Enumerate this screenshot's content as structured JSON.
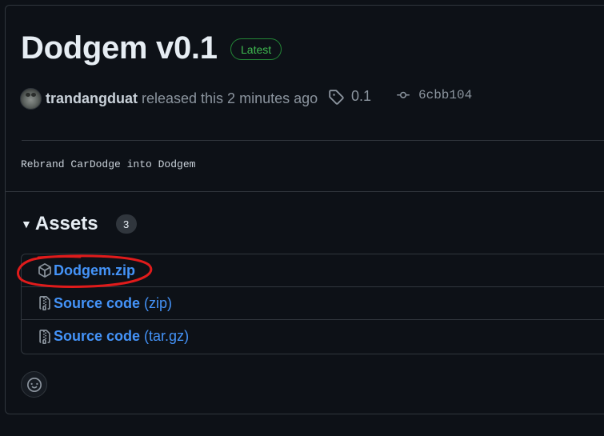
{
  "release": {
    "title": "Dodgem v0.1",
    "badge": "Latest",
    "author": "trandangduat",
    "released_text": "released this 2 minutes ago",
    "tag": "0.1",
    "commit": "6cbb104",
    "notes": "Rebrand CarDodge into Dodgem"
  },
  "assets": {
    "title": "Assets",
    "count": "3",
    "items": [
      {
        "name": "Dodgem.zip",
        "suffix": "",
        "icon": "package-icon"
      },
      {
        "name": "Source code",
        "suffix": "(zip)",
        "icon": "file-zip-icon"
      },
      {
        "name": "Source code",
        "suffix": "(tar.gz)",
        "icon": "file-zip-icon"
      }
    ]
  },
  "annotation": {
    "color": "#e01b1b"
  },
  "colors": {
    "link": "#4493f8",
    "badge_green": "#3fb950",
    "background": "#0d1117",
    "border": "#30363d"
  }
}
